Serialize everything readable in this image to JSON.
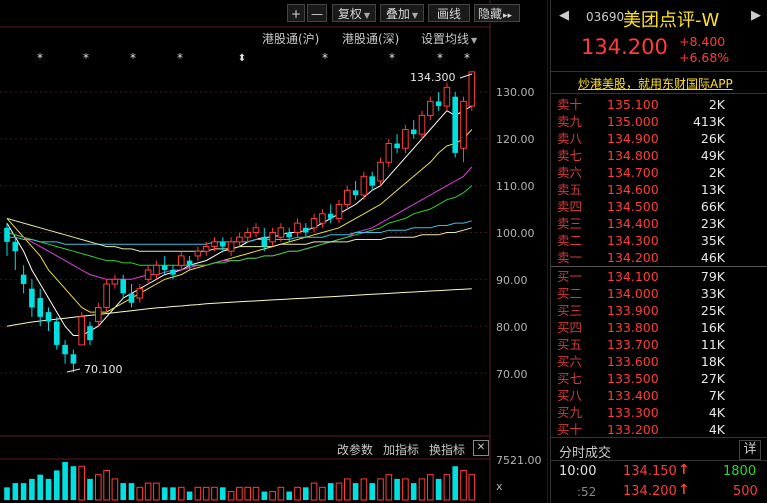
{
  "toolbar": {
    "zoom_in": "+",
    "zoom_out": "—",
    "adjust_label": "复权",
    "overlay_label": "叠加",
    "draw_label": "画线",
    "hide_label": "隐藏",
    "expand_label": "▸▸"
  },
  "subtoolbar": {
    "sh_connect": "港股通(沪)",
    "sz_connect": "港股通(深)",
    "ma_settings": "设置均线"
  },
  "chart_data": {
    "type": "candlestick",
    "y_ticks": [
      "130.00",
      "120.00",
      "110.00",
      "100.00",
      "90.00",
      "80.00",
      "70.00"
    ],
    "ylim": [
      65,
      138
    ],
    "high_annotation": "134.300",
    "low_annotation": "70.100",
    "candles": [
      {
        "o": 101,
        "c": 98,
        "h": 102,
        "l": 95
      },
      {
        "o": 98,
        "c": 96,
        "h": 99,
        "l": 92
      },
      {
        "o": 91,
        "c": 89,
        "h": 93,
        "l": 87
      },
      {
        "o": 88,
        "c": 84,
        "h": 90,
        "l": 82
      },
      {
        "o": 86,
        "c": 82,
        "h": 88,
        "l": 80
      },
      {
        "o": 83,
        "c": 81,
        "h": 84,
        "l": 79
      },
      {
        "o": 81,
        "c": 76,
        "h": 82,
        "l": 75
      },
      {
        "o": 76,
        "c": 74,
        "h": 77,
        "l": 72
      },
      {
        "o": 74,
        "c": 72,
        "h": 75,
        "l": 70.1
      },
      {
        "o": 76,
        "c": 82,
        "h": 83,
        "l": 76
      },
      {
        "o": 80,
        "c": 77,
        "h": 81,
        "l": 76
      },
      {
        "o": 81,
        "c": 84,
        "h": 85,
        "l": 80
      },
      {
        "o": 84,
        "c": 89,
        "h": 90,
        "l": 83
      },
      {
        "o": 89,
        "c": 90,
        "h": 91,
        "l": 88
      },
      {
        "o": 90,
        "c": 87,
        "h": 91,
        "l": 86
      },
      {
        "o": 87,
        "c": 85,
        "h": 89,
        "l": 84
      },
      {
        "o": 86,
        "c": 88,
        "h": 89,
        "l": 85
      },
      {
        "o": 90,
        "c": 92,
        "h": 93,
        "l": 89
      },
      {
        "o": 91,
        "c": 93,
        "h": 94,
        "l": 90
      },
      {
        "o": 93,
        "c": 92,
        "h": 95,
        "l": 91
      },
      {
        "o": 92,
        "c": 91,
        "h": 93,
        "l": 90
      },
      {
        "o": 93,
        "c": 95,
        "h": 96,
        "l": 92
      },
      {
        "o": 94,
        "c": 93,
        "h": 95,
        "l": 92
      },
      {
        "o": 95,
        "c": 96,
        "h": 97,
        "l": 94
      },
      {
        "o": 96,
        "c": 97,
        "h": 98,
        "l": 95
      },
      {
        "o": 97,
        "c": 98,
        "h": 99,
        "l": 96
      },
      {
        "o": 98,
        "c": 97,
        "h": 99,
        "l": 96
      },
      {
        "o": 96,
        "c": 98,
        "h": 99,
        "l": 95
      },
      {
        "o": 98,
        "c": 99,
        "h": 100,
        "l": 97
      },
      {
        "o": 99,
        "c": 100,
        "h": 101,
        "l": 98
      },
      {
        "o": 100,
        "c": 101,
        "h": 102,
        "l": 99
      },
      {
        "o": 99,
        "c": 97,
        "h": 101,
        "l": 96
      },
      {
        "o": 98,
        "c": 100,
        "h": 101,
        "l": 97
      },
      {
        "o": 99,
        "c": 101,
        "h": 102,
        "l": 98
      },
      {
        "o": 100,
        "c": 99,
        "h": 101,
        "l": 98
      },
      {
        "o": 100,
        "c": 102,
        "h": 103,
        "l": 99
      },
      {
        "o": 101,
        "c": 100,
        "h": 102,
        "l": 99
      },
      {
        "o": 101,
        "c": 103,
        "h": 104,
        "l": 100
      },
      {
        "o": 102,
        "c": 104,
        "h": 105,
        "l": 101
      },
      {
        "o": 104,
        "c": 103,
        "h": 106,
        "l": 102
      },
      {
        "o": 103,
        "c": 106,
        "h": 107,
        "l": 102
      },
      {
        "o": 106,
        "c": 109,
        "h": 110,
        "l": 105
      },
      {
        "o": 109,
        "c": 108,
        "h": 111,
        "l": 107
      },
      {
        "o": 108,
        "c": 112,
        "h": 113,
        "l": 107
      },
      {
        "o": 112,
        "c": 110,
        "h": 113,
        "l": 109
      },
      {
        "o": 111,
        "c": 115,
        "h": 116,
        "l": 110
      },
      {
        "o": 115,
        "c": 119,
        "h": 120,
        "l": 114
      },
      {
        "o": 119,
        "c": 118,
        "h": 121,
        "l": 117
      },
      {
        "o": 118,
        "c": 122,
        "h": 123,
        "l": 117
      },
      {
        "o": 122,
        "c": 121,
        "h": 124,
        "l": 120
      },
      {
        "o": 121,
        "c": 125,
        "h": 126,
        "l": 120
      },
      {
        "o": 125,
        "c": 128,
        "h": 129,
        "l": 124
      },
      {
        "o": 128,
        "c": 127,
        "h": 130,
        "l": 126
      },
      {
        "o": 127,
        "c": 131,
        "h": 132,
        "l": 126
      },
      {
        "o": 129,
        "c": 117,
        "h": 130,
        "l": 116
      },
      {
        "o": 118,
        "c": 128,
        "h": 129,
        "l": 115
      },
      {
        "o": 127,
        "c": 134.3,
        "h": 134.3,
        "l": 126
      }
    ],
    "ma_lines": [
      {
        "color": "#ffffff",
        "values": [
          102,
          99,
          96,
          92,
          89,
          86,
          83,
          80,
          78,
          78,
          79,
          80,
          82,
          84,
          86,
          87,
          88,
          89,
          90,
          91,
          91.5,
          92,
          93,
          93.5,
          94,
          95,
          96,
          96.5,
          97,
          98,
          98.5,
          99,
          99,
          99.5,
          100,
          100,
          100.5,
          101,
          102,
          103,
          104,
          105,
          106,
          107.5,
          109,
          110,
          112,
          114,
          116,
          118,
          120,
          122,
          124,
          126,
          125,
          126,
          127
        ]
      },
      {
        "color": "#f0e040",
        "values": [
          103,
          101,
          99,
          97,
          95,
          92,
          90,
          88,
          86,
          84,
          83,
          83,
          83,
          84,
          85,
          86,
          87,
          88,
          89,
          90,
          90.5,
          91,
          92,
          92.5,
          93,
          93.5,
          94,
          94.5,
          95,
          95.5,
          96,
          96.5,
          97,
          97.5,
          98,
          98.5,
          99,
          99.5,
          100,
          100.5,
          101,
          102,
          103,
          104,
          105,
          106,
          107.5,
          109,
          110.5,
          112,
          113.5,
          115,
          117,
          118.5,
          119,
          120,
          122
        ]
      },
      {
        "color": "#e040e0",
        "values": [
          100,
          99.5,
          99,
          98,
          97,
          96,
          95,
          94,
          93,
          92,
          91,
          90.5,
          90,
          90,
          90,
          90,
          90.5,
          91,
          91,
          91.5,
          92,
          92,
          92.5,
          93,
          93,
          93.5,
          94,
          94,
          94,
          94.5,
          94.5,
          95,
          95,
          95.5,
          96,
          96,
          96.5,
          97,
          97.5,
          98,
          98.5,
          99,
          100,
          100.5,
          101,
          102,
          103,
          104,
          105,
          106,
          107,
          108,
          109,
          110,
          111,
          112,
          114
        ]
      },
      {
        "color": "#30d030",
        "values": [
          100,
          99.5,
          99,
          98.5,
          98,
          97.5,
          97,
          96.5,
          96,
          95.5,
          95,
          94.5,
          94,
          94,
          93.5,
          93.5,
          93,
          93,
          93,
          93,
          93,
          93,
          93,
          93,
          93,
          93.5,
          93.5,
          94,
          94,
          94.5,
          94.5,
          95,
          95,
          95.5,
          96,
          96,
          96.5,
          97,
          97.5,
          98,
          98.5,
          99,
          99.5,
          100,
          100.5,
          101,
          102,
          102.5,
          103,
          104,
          104.5,
          105,
          106,
          107,
          107.5,
          108.5,
          110
        ]
      },
      {
        "color": "#40c0e0",
        "values": [
          99,
          99,
          98.5,
          98.5,
          98,
          98,
          98,
          97.5,
          97.5,
          97.5,
          97.5,
          97.5,
          97.5,
          97.5,
          97.5,
          97.5,
          97.5,
          97.5,
          97.5,
          97.5,
          97.5,
          97.5,
          97.5,
          97.5,
          97.5,
          98,
          98,
          98,
          98,
          98,
          98.5,
          98.5,
          98.5,
          98.5,
          98.5,
          99,
          99,
          99,
          99,
          99.5,
          99.5,
          99.5,
          100,
          100,
          100,
          100,
          100.5,
          100.5,
          100.5,
          101,
          101,
          101,
          101.5,
          101.5,
          102,
          102,
          102.5
        ]
      },
      {
        "color": "#e8e8a8",
        "values": [
          103,
          102.5,
          102,
          101.5,
          101,
          100.5,
          100,
          99.5,
          99,
          98.5,
          98,
          97.5,
          97,
          97,
          96.5,
          96.5,
          96,
          96,
          96,
          96,
          96,
          96,
          96,
          96,
          96,
          96.5,
          96.5,
          96.5,
          97,
          97,
          97,
          97,
          97,
          97.5,
          97.5,
          97.5,
          97.5,
          98,
          98,
          98,
          98,
          98,
          98.5,
          98.5,
          98.5,
          98.5,
          99,
          99,
          99,
          99,
          99.5,
          99.5,
          99.5,
          100,
          100,
          100.5,
          101
        ]
      },
      {
        "color": "#fff8c0",
        "values": [
          80,
          80.3,
          80.6,
          80.9,
          81.1,
          81.3,
          81.5,
          81.7,
          81.9,
          82.1,
          82.3,
          82.5,
          82.7,
          82.9,
          83.1,
          83.3,
          83.5,
          83.7,
          83.9,
          84,
          84.2,
          84.3,
          84.5,
          84.6,
          84.8,
          84.9,
          85,
          85.1,
          85.2,
          85.3,
          85.4,
          85.5,
          85.6,
          85.7,
          85.8,
          85.9,
          86,
          86.1,
          86.2,
          86.3,
          86.4,
          86.5,
          86.6,
          86.7,
          86.8,
          86.9,
          87,
          87.1,
          87.2,
          87.3,
          87.4,
          87.5,
          87.6,
          87.7,
          87.8,
          87.9,
          88
        ]
      }
    ],
    "volume": [
      3,
      4,
      4,
      5,
      6,
      5,
      7,
      9,
      8,
      8,
      5,
      6,
      7,
      5,
      4,
      4,
      3,
      4,
      4,
      3,
      3,
      3,
      2,
      3,
      3,
      3,
      3,
      2,
      3,
      3,
      3,
      2,
      2,
      3,
      2,
      3,
      3,
      4,
      3,
      4,
      4,
      5,
      4,
      5,
      4,
      5,
      6,
      5,
      5,
      4,
      5,
      6,
      5,
      6,
      8,
      7,
      6
    ],
    "volume_max_label": "7521.00",
    "volume_unit_label": "x"
  },
  "indicator_bar": {
    "change_params": "改参数",
    "add_indicator": "加指标",
    "swap_indicator": "换指标",
    "close": "✕"
  },
  "quote": {
    "code": "03690",
    "name": "美团点评-W",
    "price": "134.200",
    "change": "+8.400",
    "change_pct": "+6.68%",
    "promo": "炒港美股，就用东财国际APP"
  },
  "order_book": {
    "asks": [
      {
        "label": "卖十",
        "price": "135.100",
        "vol": "2K"
      },
      {
        "label": "卖九",
        "price": "135.000",
        "vol": "413K"
      },
      {
        "label": "卖八",
        "price": "134.900",
        "vol": "26K"
      },
      {
        "label": "卖七",
        "price": "134.800",
        "vol": "49K"
      },
      {
        "label": "卖六",
        "price": "134.700",
        "vol": "2K"
      },
      {
        "label": "卖五",
        "price": "134.600",
        "vol": "13K"
      },
      {
        "label": "卖四",
        "price": "134.500",
        "vol": "66K"
      },
      {
        "label": "卖三",
        "price": "134.400",
        "vol": "23K"
      },
      {
        "label": "卖二",
        "price": "134.300",
        "vol": "35K"
      },
      {
        "label": "卖一",
        "price": "134.200",
        "vol": "46K"
      }
    ],
    "bids": [
      {
        "label": "买一",
        "price": "134.100",
        "vol": "79K"
      },
      {
        "label": "买二",
        "price": "134.000",
        "vol": "33K"
      },
      {
        "label": "买三",
        "price": "133.900",
        "vol": "25K"
      },
      {
        "label": "买四",
        "price": "133.800",
        "vol": "16K"
      },
      {
        "label": "买五",
        "price": "133.700",
        "vol": "11K"
      },
      {
        "label": "买六",
        "price": "133.600",
        "vol": "18K"
      },
      {
        "label": "买七",
        "price": "133.500",
        "vol": "27K"
      },
      {
        "label": "买八",
        "price": "133.400",
        "vol": "7K"
      },
      {
        "label": "买九",
        "price": "133.300",
        "vol": "4K"
      },
      {
        "label": "买十",
        "price": "133.200",
        "vol": "4K"
      }
    ]
  },
  "ticks": {
    "title": "分时成交",
    "detail_btn": "详",
    "rows": [
      {
        "time": "10:00",
        "price": "134.150",
        "vol": "1800",
        "vol_color": "green"
      },
      {
        "time": ":52",
        "price": "134.200",
        "vol": "500",
        "vol_color": "red"
      }
    ]
  },
  "colors": {
    "up": "#ff3b3b",
    "down": "#00e0e0",
    "bg": "#000000",
    "grid": "#3a1a1a"
  }
}
